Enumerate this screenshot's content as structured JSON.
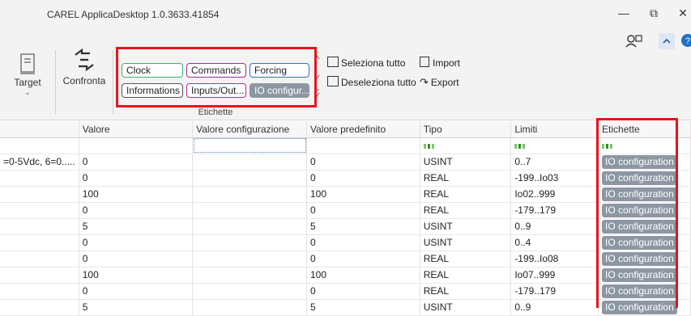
{
  "window": {
    "title": "CAREL ApplicaDesktop 1.0.3633.41854",
    "minimize": "—",
    "restore": "⧉",
    "close": "✕"
  },
  "ribbon": {
    "target_label": "Target",
    "compare_label": "Confronta",
    "tags": [
      {
        "label": "Clock",
        "color": "#3cb371"
      },
      {
        "label": "Commands",
        "color": "#9b2d8e"
      },
      {
        "label": "Forcing",
        "color": "#2e6fd1"
      },
      {
        "label": "Informations",
        "color": "#555555"
      },
      {
        "label": "Inputs/Out...",
        "color": "#c0288a"
      },
      {
        "label": "IO configur...",
        "color": "#8c97a3"
      }
    ],
    "group_label": "Etichette",
    "select_all": "Seleziona tutto",
    "deselect_all": "Deseleziona tutto",
    "import_label": "Import",
    "export_label": "Export"
  },
  "table": {
    "columns": [
      "",
      "Valore",
      "Valore configurazione",
      "Valore predefinito",
      "Tipo",
      "Limiti",
      "Etichette"
    ],
    "rows": [
      [
        "=0-5Vdc, 6=0.....",
        "0",
        "",
        "0",
        "USINT",
        "0..7",
        "IO configuration"
      ],
      [
        "",
        "0",
        "",
        "0",
        "REAL",
        "-199..Io03",
        "IO configuration"
      ],
      [
        "",
        "100",
        "",
        "100",
        "REAL",
        "Io02..999",
        "IO configuration"
      ],
      [
        "",
        "0",
        "",
        "0",
        "REAL",
        "-179..179",
        "IO configuration"
      ],
      [
        "",
        "5",
        "",
        "5",
        "USINT",
        "0..9",
        "IO configuration"
      ],
      [
        "",
        "0",
        "",
        "0",
        "USINT",
        "0..4",
        "IO configuration"
      ],
      [
        "",
        "0",
        "",
        "0",
        "REAL",
        "-199..Io08",
        "IO configuration"
      ],
      [
        "",
        "100",
        "",
        "100",
        "REAL",
        "Io07..999",
        "IO configuration"
      ],
      [
        "",
        "0",
        "",
        "0",
        "REAL",
        "-179..179",
        "IO configuration"
      ],
      [
        "",
        "5",
        "",
        "5",
        "USINT",
        "0..9",
        "IO configuration"
      ]
    ]
  }
}
